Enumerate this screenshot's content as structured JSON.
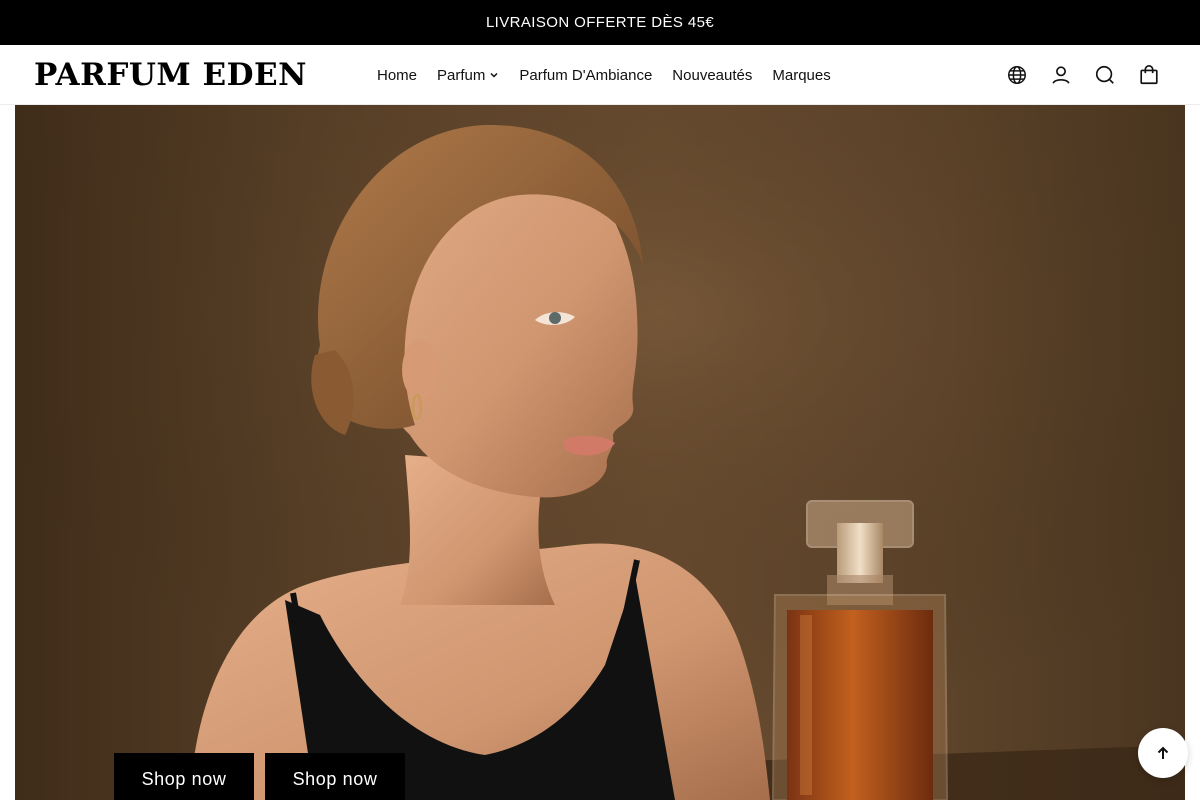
{
  "announcement": {
    "text": "LIVRAISON OFFERTE DÈS 45€"
  },
  "header": {
    "logo": "PARFUM EDEN",
    "nav": [
      {
        "label": "Home"
      },
      {
        "label": "Parfum",
        "has_dropdown": true
      },
      {
        "label": "Parfum D'Ambiance"
      },
      {
        "label": "Nouveautés"
      },
      {
        "label": "Marques"
      }
    ],
    "icons": [
      "globe-icon",
      "account-icon",
      "search-icon",
      "cart-icon"
    ]
  },
  "hero": {
    "image_alt": "Woman in black dress beside an amber perfume bottle",
    "buttons": [
      {
        "label": "Shop now"
      },
      {
        "label": "Shop now"
      }
    ]
  },
  "scroll_top": {
    "icon": "arrow-up-icon"
  },
  "colors": {
    "announcement_bg": "#000000",
    "button_bg": "#000000",
    "hero_bg": "#5a4129"
  }
}
